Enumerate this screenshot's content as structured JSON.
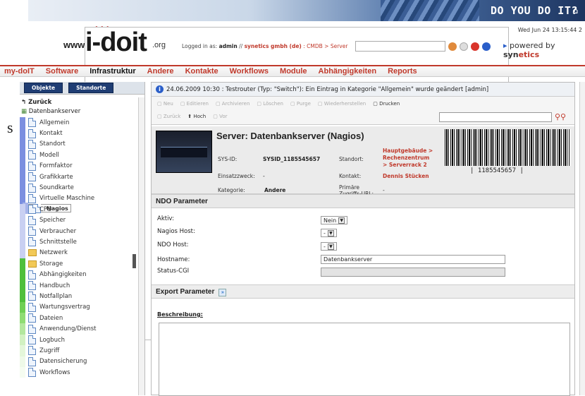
{
  "banner": {
    "slogan": "DO YOU DO IT?",
    "date": "Wed Jun 24 13:15:44 2",
    "home_icon": "home-icon"
  },
  "logo": {
    "www": "www.",
    "name": "i-doit",
    "org": ".org"
  },
  "login": {
    "prefix": "Logged in as:",
    "user": "admin",
    "sep": "//",
    "company": "synetics gmbh (de)",
    "path": ": CMDB > Server"
  },
  "powered": {
    "prefix": "powered by",
    "brand_a": "syn",
    "brand_b": "etics"
  },
  "menu": [
    "my-doIT",
    "Software",
    "Infrastruktur",
    "Andere",
    "Kontakte",
    "Workflows",
    "Module",
    "Abhängigkeiten",
    "Reports"
  ],
  "menu_active": "Infrastruktur",
  "sidebar": {
    "tabs": [
      "Objekte",
      "Standorte"
    ],
    "back": "Zurück",
    "root": "Datenbankserver",
    "items": [
      {
        "label": "Allgemein",
        "color": "#7b8fe0",
        "type": "doc"
      },
      {
        "label": "Kontakt",
        "color": "#7b8fe0",
        "type": "doc"
      },
      {
        "label": "Standort",
        "color": "#7b8fe0",
        "type": "doc"
      },
      {
        "label": "Modell",
        "color": "#7b8fe0",
        "type": "doc"
      },
      {
        "label": "Formfaktor",
        "color": "#7b8fe0",
        "type": "doc"
      },
      {
        "label": "Grafikkarte",
        "color": "#7b8fe0",
        "type": "doc"
      },
      {
        "label": "Soundkarte",
        "color": "#7b8fe0",
        "type": "doc"
      },
      {
        "label": "Virtuelle Maschine",
        "color": "#7b8fe0",
        "type": "doc"
      },
      {
        "label": "Nagios",
        "color": "#a7b4ea",
        "type": "doc",
        "selected": true
      },
      {
        "label": "CPU",
        "color": "#c9d0f2",
        "type": "doc"
      },
      {
        "label": "Speicher",
        "color": "#c9d0f2",
        "type": "doc"
      },
      {
        "label": "Verbraucher",
        "color": "#c9d0f2",
        "type": "doc"
      },
      {
        "label": "Schnittstelle",
        "color": "#c9d0f2",
        "type": "doc"
      },
      {
        "label": "Netzwerk",
        "color": "#c9d0f2",
        "type": "folder"
      },
      {
        "label": "Storage",
        "color": "#4fbf3c",
        "type": "folder"
      },
      {
        "label": "Abhängigkeiten",
        "color": "#4fbf3c",
        "type": "doc"
      },
      {
        "label": "Handbuch",
        "color": "#4fbf3c",
        "type": "doc"
      },
      {
        "label": "Notfallplan",
        "color": "#4fbf3c",
        "type": "doc"
      },
      {
        "label": "Wartungsvertrag",
        "color": "#6fcf55",
        "type": "doc"
      },
      {
        "label": "Dateien",
        "color": "#8fdc74",
        "type": "doc"
      },
      {
        "label": "Anwendung/Dienst",
        "color": "#b3e79e",
        "type": "doc"
      },
      {
        "label": "Logbuch",
        "color": "#d2f1c2",
        "type": "doc"
      },
      {
        "label": "Zugriff",
        "color": "#e4f6da",
        "type": "doc"
      },
      {
        "label": "Datensicherung",
        "color": "#eef9e8",
        "type": "doc"
      },
      {
        "label": "Workflows",
        "color": "#f5fcf1",
        "type": "doc"
      }
    ]
  },
  "message": "24.06.2009 10:30 : Testrouter (Typ: \"Switch\"): Ein Eintrag in Kategorie \"Allgemein\" wurde geändert [admin]",
  "actions": {
    "row1": [
      {
        "label": "Neu",
        "enabled": false
      },
      {
        "label": "Editieren",
        "enabled": false
      },
      {
        "label": "Archivieren",
        "enabled": false
      },
      {
        "label": "Löschen",
        "enabled": false
      },
      {
        "label": "Purge",
        "enabled": false
      },
      {
        "label": "Wiederherstellen",
        "enabled": false
      },
      {
        "label": "Drucken",
        "enabled": true
      }
    ],
    "row2": [
      {
        "label": "Zurück",
        "enabled": false
      },
      {
        "label": "Hoch",
        "enabled": true
      },
      {
        "label": "Vor",
        "enabled": false
      }
    ]
  },
  "object": {
    "title": "Server: Datenbankserver (Nagios)",
    "sysid_label": "SYS-ID:",
    "sysid": "SYSID_1185545657",
    "einsatz_label": "Einsatzzweck:",
    "einsatz": "-",
    "kategorie_label": "Kategorie:",
    "kategorie": "Andere",
    "standort_label": "Standort:",
    "standort": [
      "Hauptgebäude >",
      "Rechenzentrum",
      "> Serverrack 2"
    ],
    "kontakt_label": "Kontakt:",
    "kontakt": "Dennis Stücken",
    "url_label": "Primäre Zugriffs-URL:",
    "url": "-",
    "barcode": "| 1185545657 |"
  },
  "ndo": {
    "title": "NDO Parameter",
    "aktiv_label": "Aktiv:",
    "aktiv": "Nein",
    "host_label": "Nagios Host:",
    "host": "-",
    "ndo_label": "NDO Host:",
    "ndo": "-",
    "hostname_label": "Hostname:",
    "hostname": "Datenbankserver",
    "status_label": "Status-CGI",
    "status": ""
  },
  "export": {
    "title": "Export Parameter"
  },
  "beschreibung": "Beschreibung:",
  "left_cut": "s"
}
